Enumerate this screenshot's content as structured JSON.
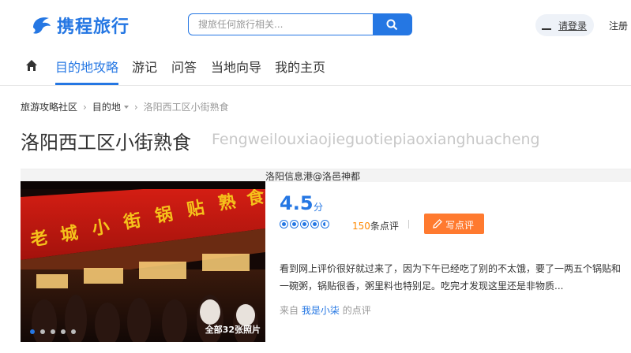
{
  "header": {
    "logo_text": "携程旅行",
    "search_placeholder": "搜旅任何旅行相关...",
    "login_label": "请登录",
    "register_label": "注册"
  },
  "nav": {
    "items": [
      "目的地攻略",
      "游记",
      "问答",
      "当地向导",
      "我的主页"
    ],
    "active_index": 0
  },
  "breadcrumb": {
    "items": [
      "旅游攻略社区",
      "目的地",
      "洛阳西工区小街熟食"
    ]
  },
  "page": {
    "title": "洛阳西工区小街熟食",
    "title_en": "Fengweilouxiaojieguotiepiaoxianghuacheng"
  },
  "watermark": "洛阳信息港@洛邑神都",
  "photo": {
    "count_label": "全部32张照片",
    "slides": 5,
    "active_slide": 0
  },
  "rating": {
    "score": "4.5",
    "unit": "分",
    "stars": 4.5,
    "review_count": "150",
    "review_suffix": "条点评",
    "write_label": "写点评"
  },
  "review": {
    "text": "看到网上评价很好就过来了，因为下午已经吃了别的不太饿，要了一两五个锅贴和一碗粥，锅贴很香，粥里料也特别足。吃完才发现这里还是非物质...",
    "from_prefix": "来自",
    "from_user": "我是小柒",
    "from_suffix": "的点评"
  },
  "colors": {
    "brand": "#2577e3",
    "accent": "#ff7a2f",
    "count": "#ff8800"
  }
}
